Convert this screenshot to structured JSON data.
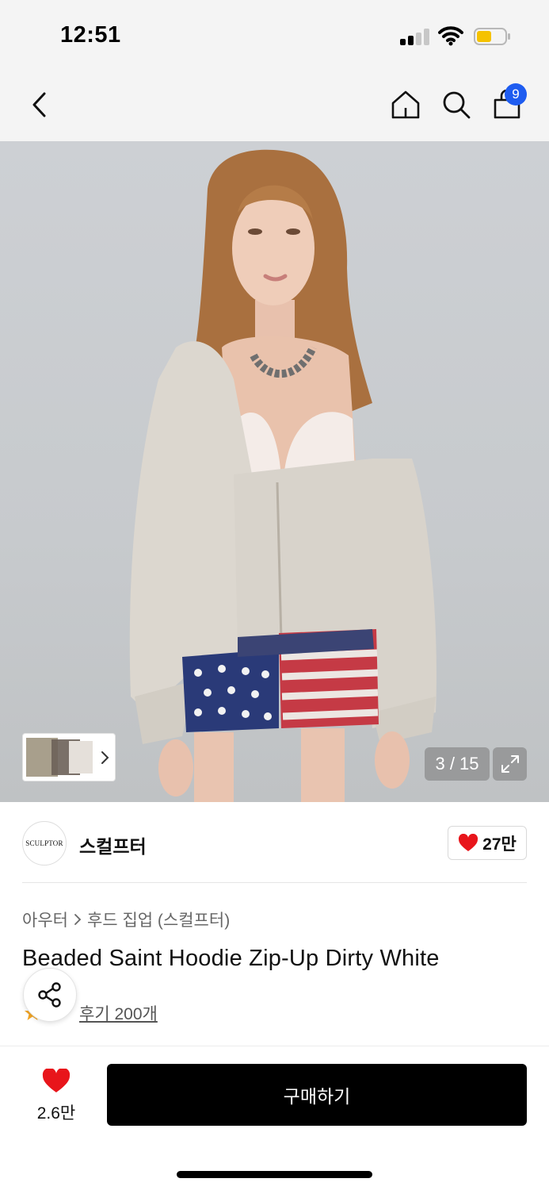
{
  "status_bar": {
    "time": "12:51"
  },
  "header": {
    "back_icon": "chevron-left-icon",
    "home_icon": "home-icon",
    "search_icon": "search-icon",
    "cart_icon": "shopping-bag-icon",
    "cart_count": "9",
    "badge_color": "#1e5cf0"
  },
  "gallery": {
    "counter": "3 / 15",
    "expand_icon": "expand-icon"
  },
  "brand": {
    "logo_text": "SCULPTOR",
    "name": "스컬프터",
    "like_count": "27만"
  },
  "product": {
    "breadcrumb": [
      "아우터",
      "후드 집업 (스컬프터)"
    ],
    "title": "Beaded Saint Hoodie Zip-Up Dirty White",
    "review_link": "후기 200개"
  },
  "bottom_bar": {
    "wish_count": "2.6만",
    "buy_label": "구매하기",
    "heart_color": "#e8151b"
  }
}
